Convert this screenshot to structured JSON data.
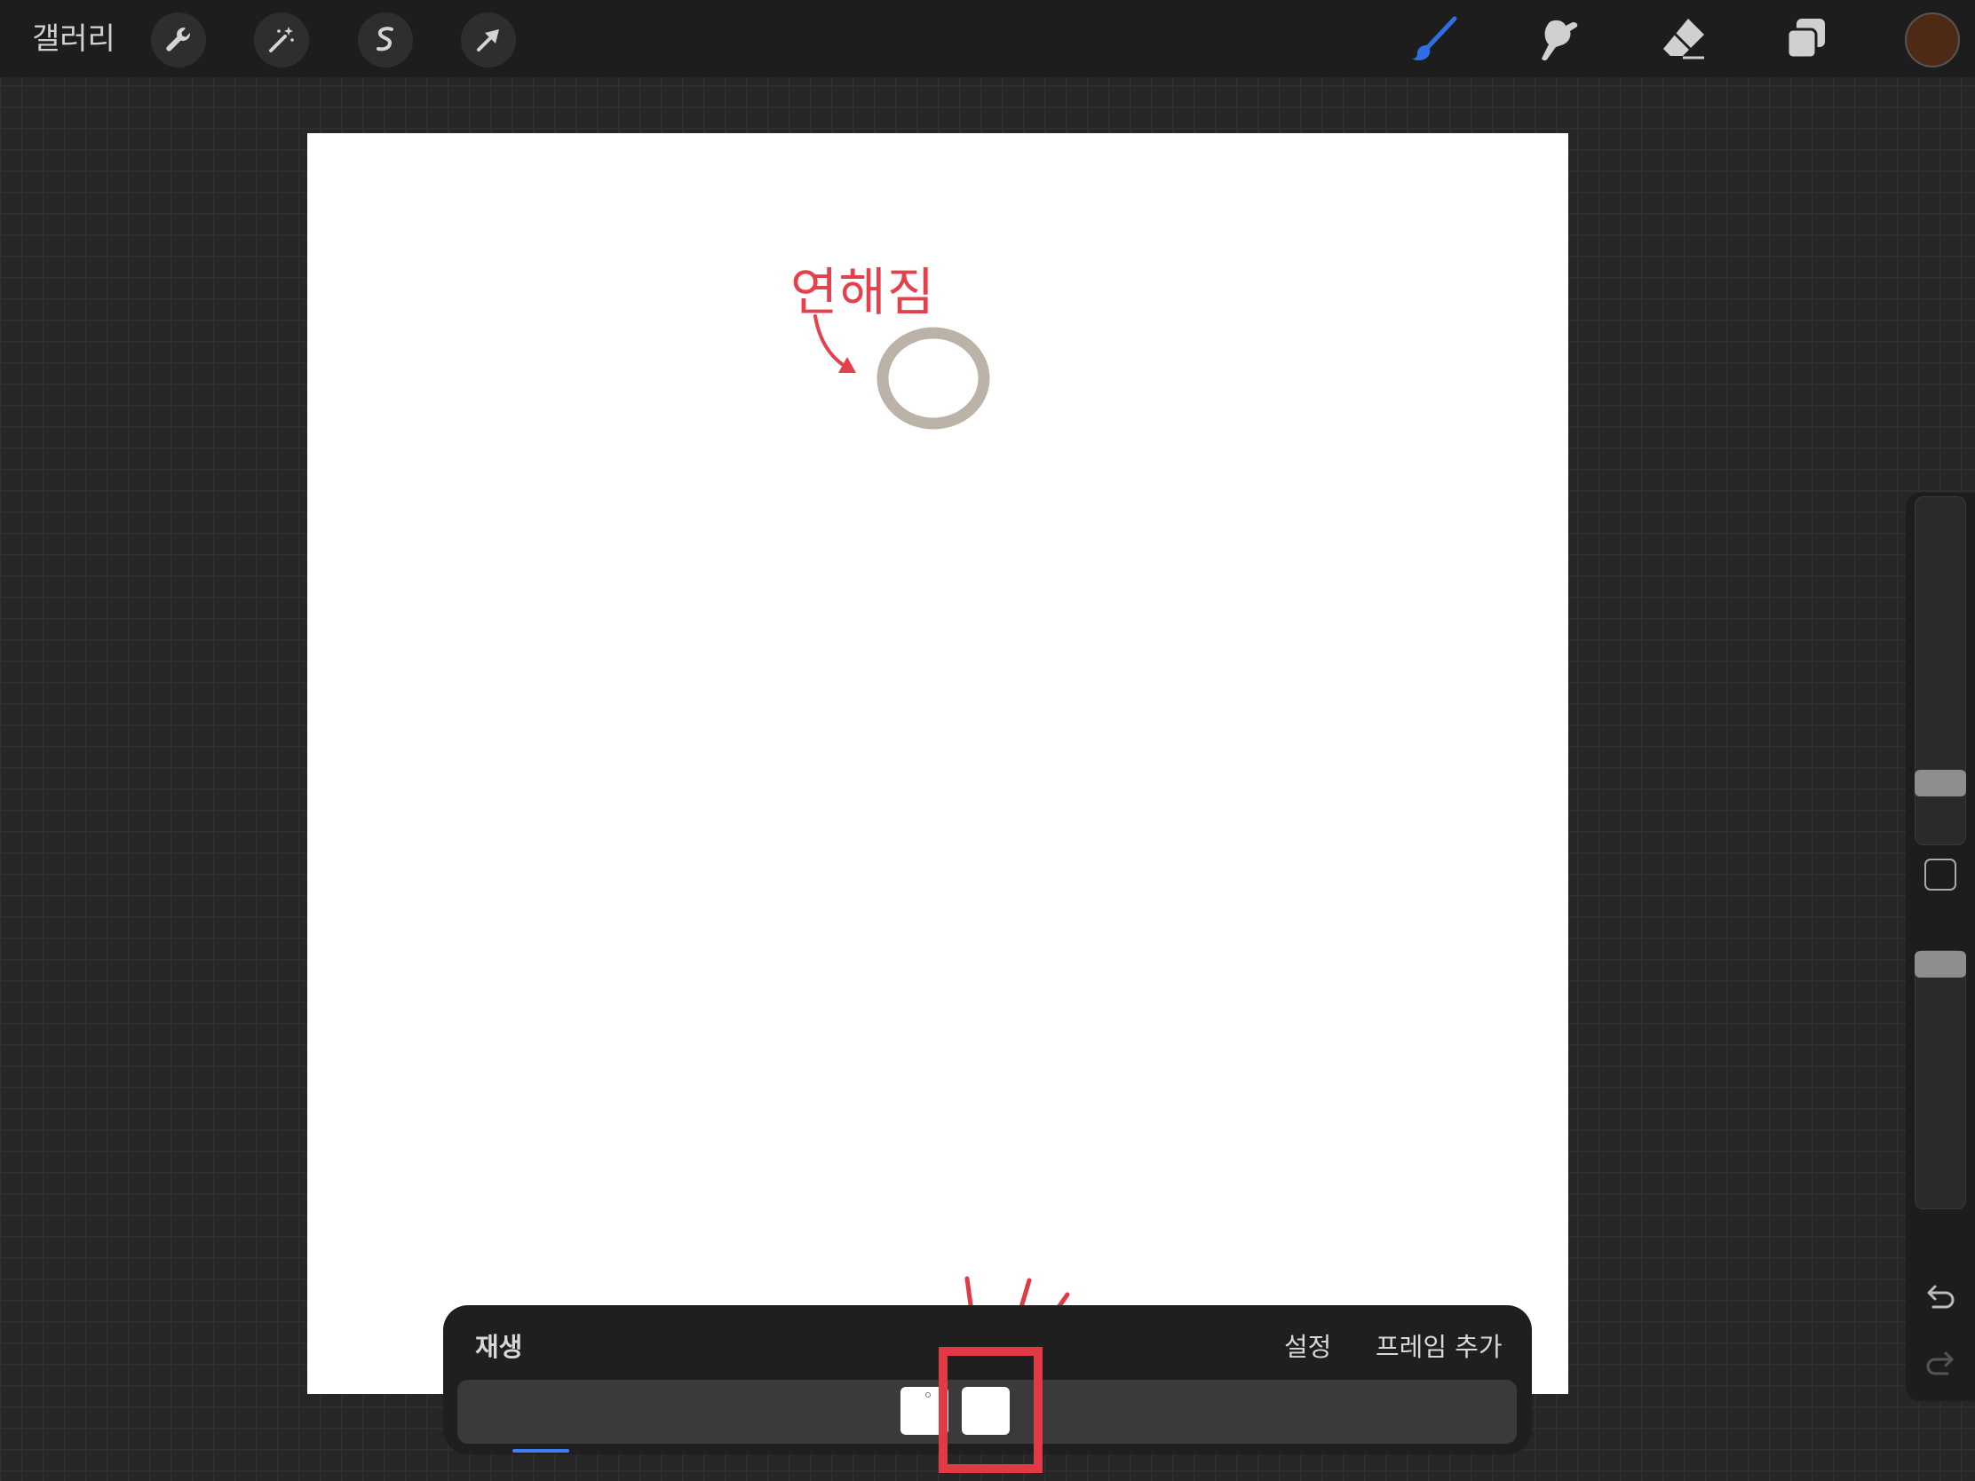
{
  "header": {
    "gallery_label": "갤러리",
    "left_tools": [
      "wrench-icon",
      "magic-wand-icon",
      "selection-icon",
      "move-arrow-icon"
    ],
    "right_tools": [
      "brush-icon",
      "smudge-icon",
      "eraser-icon",
      "layers-icon"
    ],
    "active_tool": "brush-icon",
    "current_color": "#4e2a16",
    "active_color": "#2f6fe4"
  },
  "canvas": {
    "annotation_text": "연해짐",
    "annotation_color": "#e5414c",
    "circle_stroke_color": "#bbb2a8"
  },
  "sidebar": {
    "controls": [
      "brush-size-slider",
      "modify-button",
      "opacity-slider",
      "undo-icon",
      "redo-icon"
    ]
  },
  "animation_panel": {
    "play_label": "재생",
    "settings_label": "설정",
    "add_frame_label": "프레임 추가",
    "frame_count": 2,
    "selected_frame": 2,
    "highlight_color": "#e23a45"
  }
}
